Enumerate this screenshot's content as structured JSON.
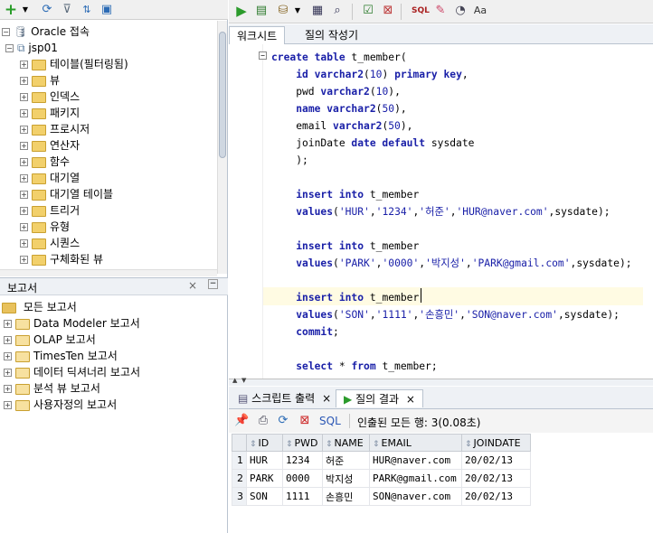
{
  "left_tree": {
    "connection_root": "Oracle 접속",
    "schema": "jsp01",
    "items": [
      "테이블(필터링됨)",
      "뷰",
      "인덱스",
      "패키지",
      "프로시저",
      "연산자",
      "함수",
      "대기열",
      "대기열 테이블",
      "트리거",
      "유형",
      "시퀀스",
      "구체화된 뷰"
    ]
  },
  "reports": {
    "title": "보고서",
    "root": "모든 보고서",
    "items": [
      "Data Modeler 보고서",
      "OLAP 보고서",
      "TimesTen 보고서",
      "데이터 딕셔너리 보고서",
      "분석 뷰 보고서",
      "사용자정의 보고서"
    ]
  },
  "tabs": [
    "워크시트",
    "질의 작성기"
  ],
  "code_lines": [
    {
      "parts": [
        {
          "k": "kw",
          "t": "create table "
        },
        {
          "k": "",
          "t": "t_member("
        }
      ]
    },
    {
      "parts": [
        {
          "k": "",
          "t": "    "
        },
        {
          "k": "kw",
          "t": "id varchar2"
        },
        {
          "k": "",
          "t": "("
        },
        {
          "k": "ln",
          "t": "10"
        },
        {
          "k": "",
          "t": ") "
        },
        {
          "k": "kw",
          "t": "primary key"
        },
        {
          "k": "",
          "t": ","
        }
      ]
    },
    {
      "parts": [
        {
          "k": "",
          "t": "    pwd "
        },
        {
          "k": "kw",
          "t": "varchar2"
        },
        {
          "k": "",
          "t": "("
        },
        {
          "k": "ln",
          "t": "10"
        },
        {
          "k": "",
          "t": "),"
        }
      ]
    },
    {
      "parts": [
        {
          "k": "",
          "t": "    "
        },
        {
          "k": "kw",
          "t": "name varchar2"
        },
        {
          "k": "",
          "t": "("
        },
        {
          "k": "ln",
          "t": "50"
        },
        {
          "k": "",
          "t": "),"
        }
      ]
    },
    {
      "parts": [
        {
          "k": "",
          "t": "    email "
        },
        {
          "k": "kw",
          "t": "varchar2"
        },
        {
          "k": "",
          "t": "("
        },
        {
          "k": "ln",
          "t": "50"
        },
        {
          "k": "",
          "t": "),"
        }
      ]
    },
    {
      "parts": [
        {
          "k": "",
          "t": "    joinDate "
        },
        {
          "k": "kw",
          "t": "date default "
        },
        {
          "k": "",
          "t": "sysdate"
        }
      ]
    },
    {
      "parts": [
        {
          "k": "",
          "t": "    );"
        }
      ]
    },
    {
      "parts": [
        {
          "k": "",
          "t": ""
        }
      ]
    },
    {
      "parts": [
        {
          "k": "",
          "t": "    "
        },
        {
          "k": "kw",
          "t": "insert into "
        },
        {
          "k": "",
          "t": "t_member"
        }
      ]
    },
    {
      "parts": [
        {
          "k": "",
          "t": "    "
        },
        {
          "k": "kw",
          "t": "values"
        },
        {
          "k": "",
          "t": "("
        },
        {
          "k": "st",
          "t": "'HUR'"
        },
        {
          "k": "",
          "t": ","
        },
        {
          "k": "st",
          "t": "'1234'"
        },
        {
          "k": "",
          "t": ","
        },
        {
          "k": "st",
          "t": "'허준'"
        },
        {
          "k": "",
          "t": ","
        },
        {
          "k": "st",
          "t": "'HUR@naver.com'"
        },
        {
          "k": "",
          "t": ",sysdate);"
        }
      ]
    },
    {
      "parts": [
        {
          "k": "",
          "t": ""
        }
      ]
    },
    {
      "parts": [
        {
          "k": "",
          "t": "    "
        },
        {
          "k": "kw",
          "t": "insert into "
        },
        {
          "k": "",
          "t": "t_member"
        }
      ]
    },
    {
      "parts": [
        {
          "k": "",
          "t": "    "
        },
        {
          "k": "kw",
          "t": "values"
        },
        {
          "k": "",
          "t": "("
        },
        {
          "k": "st",
          "t": "'PARK'"
        },
        {
          "k": "",
          "t": ","
        },
        {
          "k": "st",
          "t": "'0000'"
        },
        {
          "k": "",
          "t": ","
        },
        {
          "k": "st",
          "t": "'박지성'"
        },
        {
          "k": "",
          "t": ","
        },
        {
          "k": "st",
          "t": "'PARK@gmail.com'"
        },
        {
          "k": "",
          "t": ",sysdate);"
        }
      ]
    },
    {
      "parts": [
        {
          "k": "",
          "t": ""
        }
      ]
    },
    {
      "parts": [
        {
          "k": "",
          "t": "    "
        },
        {
          "k": "kw",
          "t": "insert into "
        },
        {
          "k": "",
          "t": "t_member"
        }
      ]
    },
    {
      "parts": [
        {
          "k": "",
          "t": "    "
        },
        {
          "k": "kw",
          "t": "values"
        },
        {
          "k": "",
          "t": "("
        },
        {
          "k": "st",
          "t": "'SON'"
        },
        {
          "k": "",
          "t": ","
        },
        {
          "k": "st",
          "t": "'1111'"
        },
        {
          "k": "",
          "t": ","
        },
        {
          "k": "st",
          "t": "'손흥민'"
        },
        {
          "k": "",
          "t": ","
        },
        {
          "k": "st",
          "t": "'SON@naver.com'"
        },
        {
          "k": "",
          "t": ",sysdate);"
        }
      ]
    },
    {
      "parts": [
        {
          "k": "",
          "t": "    "
        },
        {
          "k": "kw",
          "t": "commit"
        },
        {
          "k": "",
          "t": ";"
        }
      ]
    },
    {
      "parts": [
        {
          "k": "",
          "t": ""
        }
      ]
    },
    {
      "parts": [
        {
          "k": "",
          "t": "    "
        },
        {
          "k": "kw",
          "t": "select "
        },
        {
          "k": "",
          "t": "* "
        },
        {
          "k": "kw",
          "t": "from "
        },
        {
          "k": "",
          "t": "t_member;"
        }
      ]
    }
  ],
  "output_tabs": [
    "스크립트 출력",
    "질의 결과"
  ],
  "output_toolbar": {
    "sql_label": "SQL",
    "status": "인출된 모든 행: 3(0.08초)"
  },
  "results": {
    "columns": [
      "ID",
      "PWD",
      "NAME",
      "EMAIL",
      "JOINDATE"
    ],
    "rows": [
      [
        "1",
        "HUR",
        "1234",
        "허준",
        "HUR@naver.com",
        "20/02/13"
      ],
      [
        "2",
        "PARK",
        "0000",
        "박지성",
        "PARK@gmail.com",
        "20/02/13"
      ],
      [
        "3",
        "SON",
        "1111",
        "손흥민",
        "SON@naver.com",
        "20/02/13"
      ]
    ]
  },
  "colors": {
    "keyword": "#1a20a8",
    "current_line": "#fffbe3",
    "panel_bg": "#eef1f5"
  }
}
